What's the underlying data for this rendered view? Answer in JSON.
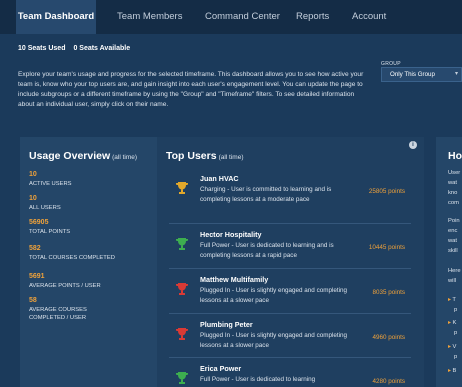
{
  "nav": {
    "tabs": [
      {
        "label": "Team Dashboard",
        "active": true
      },
      {
        "label": "Team Members",
        "active": false
      },
      {
        "label": "Command Center",
        "active": false
      },
      {
        "label": "Reports",
        "active": false
      },
      {
        "label": "Account",
        "active": false
      }
    ]
  },
  "seats": {
    "used": "10 Seats Used",
    "available": "0 Seats Available"
  },
  "description": "Explore your team's usage and progress for the selected timeframe. This dashboard allows you to see how active your team is, know who your top users are, and gain insight into each user's engagement level. You can update the page to include subgroups or a different timeframe by using the \"Group\" and \"Timeframe\" filters. To see detailed information about an individual user, simply click on their name.",
  "group_filter": {
    "label": "GROUP",
    "value": "Only This Group"
  },
  "usage_overview": {
    "title": "Usage Overview",
    "subtitle": "(all time)",
    "stats": [
      {
        "value": "10",
        "label": "ACTIVE USERS"
      },
      {
        "value": "10",
        "label": "ALL USERS"
      },
      {
        "value": "56905",
        "label": "TOTAL POINTS"
      },
      {
        "value": "582",
        "label": "TOTAL COURSES COMPLETED"
      },
      {
        "value": "5691",
        "label": "AVERAGE POINTS / USER"
      },
      {
        "value": "58",
        "label": "AVERAGE COURSES COMPLETED / USER"
      }
    ]
  },
  "top_users": {
    "title": "Top Users",
    "subtitle": "(all time)",
    "users": [
      {
        "name": "Juan HVAC",
        "detail": "Charging - User is committed to learning and is completing lessons at a moderate pace",
        "points": "25805 points",
        "trophy_color": "#e2a82b"
      },
      {
        "name": "Hector Hospitality",
        "detail": "Full Power - User is dedicated to learning and is completing lessons at a rapid pace",
        "points": "10445 points",
        "trophy_color": "#3dae4f"
      },
      {
        "name": "Matthew Multifamily",
        "detail": "Plugged In - User is slightly engaged and completing lessons at a slower pace",
        "points": "8035 points",
        "trophy_color": "#d93a35"
      },
      {
        "name": "Plumbing Peter",
        "detail": "Plugged In - User is slightly engaged and completing lessons at a slower pace",
        "points": "4960 points",
        "trophy_color": "#d93a35"
      },
      {
        "name": "Erica Power",
        "detail": "Full Power - User is dedicated to learning",
        "points": "4280 points",
        "trophy_color": "#3dae4f"
      }
    ]
  },
  "how_panel": {
    "title": "How",
    "lines_a": [
      "User",
      "wat",
      "kno",
      "com"
    ],
    "lines_b": [
      "Poin",
      "enc",
      "wat",
      "skill"
    ],
    "lines_c": [
      "Here",
      "will"
    ],
    "bullet_lines": [
      "T",
      "p",
      "K",
      "p",
      "V",
      "p",
      "B"
    ]
  },
  "colors": {
    "background": "#1b3a5b",
    "nav": "#142c46",
    "accent": "#f0a23a",
    "panel": "#244668"
  }
}
